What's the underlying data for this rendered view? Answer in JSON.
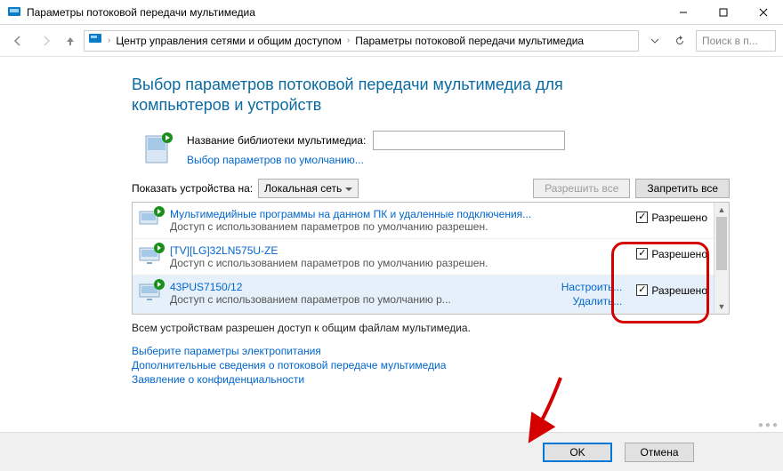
{
  "window": {
    "title": "Параметры потоковой передачи мультимедиа"
  },
  "breadcrumb": {
    "item1": "Центр управления сетями и общим доступом",
    "item2": "Параметры потоковой передачи мультимедиа"
  },
  "search": {
    "placeholder": "Поиск в п..."
  },
  "page": {
    "heading": "Выбор параметров потоковой передачи мультимедиа для компьютеров и устройств"
  },
  "library": {
    "label": "Название библиотеки мультимедиа:",
    "default_link": "Выбор параметров по умолчанию..."
  },
  "filter": {
    "label": "Показать устройства на:",
    "combo_value": "Локальная сеть",
    "allow_all": "Разрешить все",
    "block_all": "Запретить все"
  },
  "devices": [
    {
      "name": "Мультимедийные программы на данном ПК и удаленные подключения...",
      "sub": "Доступ с использованием параметров по умолчанию разрешен.",
      "allowed_label": "Разрешено"
    },
    {
      "name": "[TV][LG]32LN575U-ZE",
      "sub": "Доступ с использованием параметров по умолчанию разрешен.",
      "allowed_label": "Разрешено"
    },
    {
      "name": "43PUS7150/12",
      "sub": "Доступ с использованием параметров по умолчанию р...",
      "allowed_label": "Разрешено",
      "action_configure": "Настроить...",
      "action_remove": "Удалить..."
    }
  ],
  "summary": "Всем устройствам разрешен доступ к общим файлам мультимедиа.",
  "links": {
    "power": "Выберите параметры электропитания",
    "more": "Дополнительные сведения о потоковой передаче мультимедиа",
    "privacy": "Заявление о конфиденциальности"
  },
  "buttons": {
    "ok": "OK",
    "cancel": "Отмена"
  }
}
